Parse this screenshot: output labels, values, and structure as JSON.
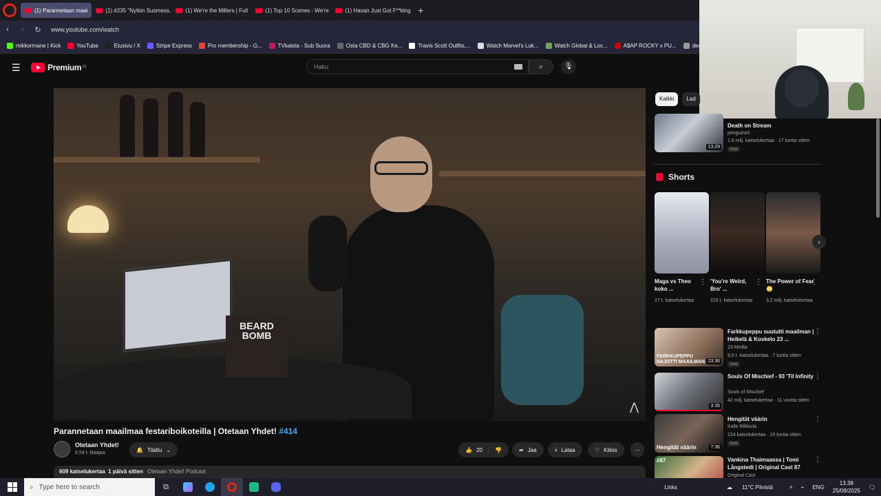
{
  "browser": {
    "tabs": [
      {
        "label": "(1) Parannetaan maai",
        "active": true
      },
      {
        "label": "(1) #235 \"Nytkin Suomess..."
      },
      {
        "label": "(1) We're the Millers | Full"
      },
      {
        "label": "(1) Top 10 Scenes - We're"
      },
      {
        "label": "(1) Hasan Just Got F**king"
      }
    ],
    "url": "www.youtube.com/watch",
    "bookmarks": [
      {
        "label": "mikkormane | Kick",
        "color": "#53fc18"
      },
      {
        "label": "YouTube",
        "color": "#ff0033"
      },
      {
        "label": "Etusivu / X",
        "color": "#222222"
      },
      {
        "label": "Stripe Express",
        "color": "#635bff"
      },
      {
        "label": "Pro membership - G...",
        "color": "#ea4335"
      },
      {
        "label": "TVkaista - Sub Suora",
        "color": "#c2185b"
      },
      {
        "label": "Osta CBD & CBG Ke...",
        "color": "#666666"
      },
      {
        "label": "Travis Scott Outfits,...",
        "color": "#ffffff"
      },
      {
        "label": "Watch Marvel's Luk...",
        "color": "#dddddd"
      },
      {
        "label": "Watch Global & Loc...",
        "color": "#6aa84f"
      },
      {
        "label": "A$AP ROCKY x PU...",
        "color": "#cc0000"
      },
      {
        "label": "deceived",
        "color": "#999999"
      }
    ]
  },
  "youtube": {
    "logo_text": "Premium",
    "region": "FI",
    "search_placeholder": "Haku"
  },
  "video": {
    "title": "Parannetaan maailmaa festariboikoteilla | Otetaan Yhdet!",
    "hashtag": "#414",
    "channel": "Otetaan Yhdet!",
    "subscribers": "6,54 t. tilaajaa",
    "subscribe_label": "Tilattu",
    "likes": "20",
    "share_label": "Jaa",
    "download_label": "Lataa",
    "thanks_label": "Kiitos",
    "views": "609 katselukertaa",
    "age": "1 päivä sitten",
    "tags": "Otetaan Yhdet! Podcast",
    "box_text": "BEARD BOMB"
  },
  "sidebar": {
    "chips": [
      {
        "label": "Kaikki",
        "selected": true
      },
      {
        "label": "Lad",
        "selected": false
      }
    ],
    "top_item": {
      "title": "Death on Stream",
      "channel": "penguinz0",
      "meta": "1,8 milj. katselukertaa · 17 tuntia sitten",
      "badge": "Uusi",
      "duration": "13:29"
    },
    "shorts_title": "Shorts",
    "shorts": [
      {
        "title": "Maga vs Theo koko ...",
        "views": "27 t. katselukertaa"
      },
      {
        "title": "'You're Weird, Bro' ...",
        "views": "215 t. katselukertaa"
      },
      {
        "title": "The Power of Fear 😳",
        "views": "3,2 milj. katselukertaa"
      }
    ],
    "items": [
      {
        "title": "Farkkupeppu suututti maailman | Heikelä & Koskelo 23 ...",
        "channel": "23 Media",
        "meta": "9,5 t. katselukertaa · 7 tuntia sitten",
        "badge": "Uusi",
        "duration": "23:36",
        "thumb_text": "FARKKUPEPPU HAJOTTI MAAILMAN"
      },
      {
        "title": "Souls Of Mischief - 93 'Til Infinity",
        "channel": "Souls of Mischief",
        "meta": "42 milj. katselukertaa · 11 vuotta sitten",
        "badge": "",
        "duration": "3:35",
        "thumb_text": ""
      },
      {
        "title": "Hengität väärin",
        "channel": "Kalle Rilkkula",
        "meta": "224 katselukertaa · 19 tuntia sitten",
        "badge": "Uusi",
        "duration": "7:36",
        "thumb_text": "Hengität väärin"
      },
      {
        "title": "Vankina Thaimaassa | Tomi Långstedt | Original Cast 87",
        "channel": "Original Cast",
        "meta": "",
        "badge": "",
        "duration": "",
        "thumb_text": "#87"
      }
    ]
  },
  "taskbar": {
    "search_placeholder": "Type here to search",
    "links_label": "Links",
    "weather": "11°C  Pilvistä",
    "lang": "ENG",
    "time": "13.38",
    "date": "25/08/2025"
  }
}
